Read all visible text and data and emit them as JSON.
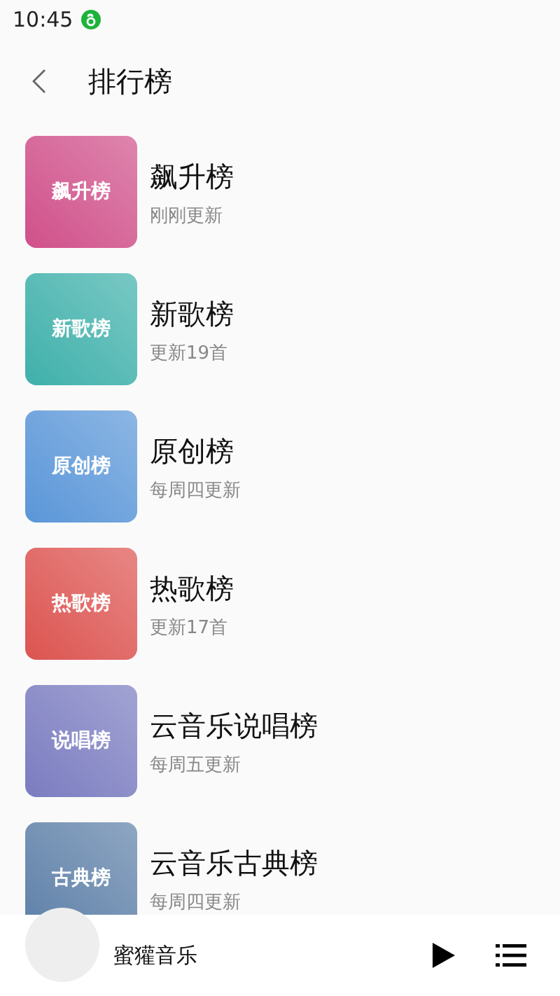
{
  "status_bar": {
    "time": "10:45"
  },
  "header": {
    "title": "排行榜"
  },
  "charts": [
    {
      "cover_label": "飙升榜",
      "name": "飙升榜",
      "update": "刚刚更新",
      "color": "#d0508a"
    },
    {
      "cover_label": "新歌榜",
      "name": "新歌榜",
      "update": "更新19首",
      "color": "#3fb0aa"
    },
    {
      "cover_label": "原创榜",
      "name": "原创榜",
      "update": "每周四更新",
      "color": "#5a96d8"
    },
    {
      "cover_label": "热歌榜",
      "name": "热歌榜",
      "update": "更新17首",
      "color": "#dc5450"
    },
    {
      "cover_label": "说唱榜",
      "name": "云音乐说唱榜",
      "update": "每周五更新",
      "color": "#7a7cc0"
    },
    {
      "cover_label": "古典榜",
      "name": "云音乐古典榜",
      "update": "每周四更新",
      "color": "#5e80a8"
    }
  ],
  "player": {
    "title": "蜜獾音乐"
  }
}
